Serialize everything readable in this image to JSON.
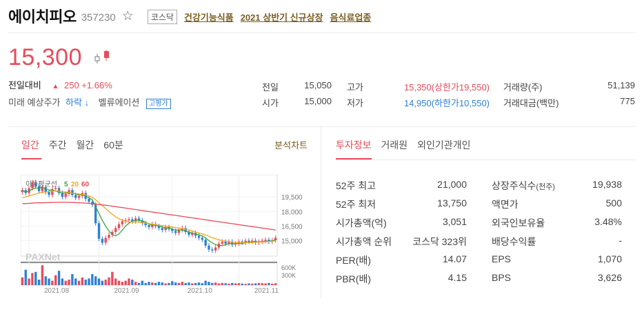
{
  "stock": {
    "name": "에이치피오",
    "code": "357230",
    "market": "코스닥",
    "tags": [
      "건강기능식품",
      "2021 상반기 신규상장",
      "음식료업종"
    ],
    "price": "15,300",
    "change_label": "전일대비",
    "change_value": "250 +1.66%",
    "future_label": "미래 예상주가",
    "future_dir": "하락 ↓",
    "valuation_label": "벨류에이션",
    "valuation_badge": "고평가"
  },
  "summary": [
    {
      "label": "전일",
      "value": "15,050"
    },
    {
      "label": "시가",
      "value": "15,000"
    },
    {
      "label": "고가",
      "value": "15,350(상한가19,550)"
    },
    {
      "label": "저가",
      "value": "14,950(하한가10,550)"
    },
    {
      "label": "거래량(주)",
      "value": "51,139"
    },
    {
      "label": "거래대금(백만)",
      "value": "775"
    }
  ],
  "chart_tabs": [
    "일간",
    "주간",
    "월간",
    "60분"
  ],
  "analysis_link": "분석차트",
  "info_tabs": [
    "투자정보",
    "거래원",
    "외인기관개인"
  ],
  "chart_data": {
    "type": "line",
    "legend_label": "이동평균선",
    "ma_periods": [
      "5",
      "20",
      "60"
    ],
    "ma_colors": [
      "#3aa53a",
      "#f5a623",
      "#e84b5b"
    ],
    "price_ticks": [
      "19,500",
      "18,000",
      "16,500",
      "15,000"
    ],
    "price_tick_values": [
      19500,
      18000,
      16500,
      15000
    ],
    "ylim": [
      13700,
      21500
    ],
    "volume_ticks": [
      "600K",
      "300K"
    ],
    "x_ticks": [
      "2021.08",
      "2021.09",
      "2021.10",
      "2021.11"
    ],
    "watermark": "PAXNet",
    "closes": [
      20200,
      19900,
      20400,
      21000,
      20600,
      20100,
      20500,
      20000,
      19700,
      20300,
      20400,
      19900,
      19500,
      19800,
      20200,
      19700,
      19400,
      19600,
      19900,
      19300,
      19000,
      18700,
      16800,
      15200,
      14800,
      15300,
      15600,
      15900,
      16300,
      16700,
      17000,
      17100,
      17200,
      17000,
      17300,
      17100,
      16800,
      16600,
      16400,
      16700,
      16500,
      16300,
      16100,
      16400,
      16200,
      16000,
      15800,
      16100,
      16300,
      15900,
      15600,
      15800,
      15500,
      15300,
      15100,
      14500,
      14100,
      14000,
      14300,
      14700,
      14900,
      14700,
      14900,
      14600,
      14700,
      14900,
      14800,
      15000,
      14900,
      15000,
      14800,
      14900,
      15000,
      15100,
      14900,
      15050,
      15300
    ],
    "ma5": [
      20200,
      20000,
      20100,
      20300,
      20400,
      20400,
      20500,
      20300,
      20200,
      20200,
      20100,
      20000,
      19900,
      19900,
      19900,
      19900,
      19800,
      19700,
      19700,
      19600,
      19400,
      19200,
      18500,
      17800,
      17100,
      16500,
      16000,
      15600,
      15500,
      15700,
      16100,
      16500,
      16800,
      17000,
      17100,
      17100,
      17000,
      16900,
      16700,
      16600,
      16600,
      16500,
      16400,
      16300,
      16300,
      16200,
      16100,
      16100,
      16100,
      16000,
      15900,
      15800,
      15700,
      15600,
      15500,
      15300,
      15000,
      14800,
      14600,
      14500,
      14500,
      14600,
      14700,
      14700,
      14700,
      14700,
      14700,
      14800,
      14850,
      14900,
      14900,
      14900,
      14900,
      14950,
      14950,
      15000,
      15100
    ],
    "ma20": [
      19400,
      19500,
      19600,
      19700,
      19800,
      19900,
      20000,
      20000,
      20050,
      20100,
      20100,
      20100,
      20050,
      20000,
      19950,
      19900,
      19850,
      19800,
      19750,
      19700,
      19600,
      19450,
      19200,
      18900,
      18600,
      18300,
      18000,
      17700,
      17450,
      17250,
      17100,
      17000,
      16950,
      16900,
      16900,
      16900,
      16850,
      16800,
      16750,
      16700,
      16650,
      16600,
      16550,
      16500,
      16450,
      16400,
      16350,
      16300,
      16250,
      16200,
      16100,
      16000,
      15900,
      15800,
      15700,
      15600,
      15450,
      15300,
      15200,
      15100,
      15000,
      14950,
      14900,
      14850,
      14820,
      14800,
      14800,
      14800,
      14800,
      14820,
      14840,
      14860,
      14880,
      14900,
      14920,
      14950,
      14980
    ],
    "ma60": [
      18800,
      18820,
      18840,
      18860,
      18880,
      18900,
      18900,
      18910,
      18920,
      18930,
      18940,
      18950,
      18950,
      18950,
      18940,
      18930,
      18920,
      18900,
      18880,
      18860,
      18840,
      18800,
      18760,
      18720,
      18680,
      18640,
      18600,
      18550,
      18500,
      18450,
      18400,
      18350,
      18300,
      18250,
      18200,
      18150,
      18100,
      18050,
      18000,
      17950,
      17900,
      17850,
      17800,
      17750,
      17700,
      17650,
      17600,
      17550,
      17500,
      17450,
      17400,
      17350,
      17300,
      17250,
      17200,
      17150,
      17100,
      17050,
      17000,
      16950,
      16900,
      16850,
      16800,
      16750,
      16700,
      16650,
      16600,
      16550,
      16500,
      16450,
      16400,
      16350,
      16300,
      16250,
      16200,
      16150,
      16100
    ],
    "volume": [
      0.35,
      0.7,
      0.3,
      0.55,
      0.6,
      0.25,
      0.9,
      0.4,
      0.3,
      0.2,
      0.45,
      0.65,
      0.3,
      0.2,
      0.25,
      0.5,
      0.3,
      0.2,
      0.35,
      0.25,
      0.3,
      0.5,
      0.4,
      0.3,
      0.2,
      0.25,
      0.35,
      0.6,
      0.3,
      0.2,
      0.15,
      0.2,
      0.3,
      0.25,
      0.15,
      0.1,
      0.2,
      0.1,
      0.15,
      0.12,
      0.1,
      0.15,
      0.12,
      0.08,
      0.1,
      0.18,
      0.12,
      0.1,
      0.15,
      0.1,
      0.12,
      0.08,
      0.1,
      0.12,
      0.09,
      0.2,
      0.15,
      0.1,
      0.12,
      0.08,
      0.1,
      0.09,
      0.07,
      0.1,
      0.08,
      0.09,
      0.07,
      0.06,
      0.08,
      0.07,
      0.08,
      0.1,
      0.09,
      0.08,
      0.1,
      0.07,
      0.09
    ]
  },
  "invest_left": [
    {
      "label": "52주 최고",
      "value": "21,000"
    },
    {
      "label": "52주 최저",
      "value": "13,750"
    },
    {
      "label": "시가총액(억)",
      "value": "3,051"
    },
    {
      "label": "시가총액 순위",
      "value": "코스닥 323위"
    },
    {
      "label": "PER(배)",
      "value": "14.07"
    },
    {
      "label": "PBR(배)",
      "value": "4.15"
    }
  ],
  "invest_right": [
    {
      "label": "상장주식수",
      "sub": "(천주)",
      "value": "19,938"
    },
    {
      "label": "액면가",
      "value": "500"
    },
    {
      "label": "외국인보유율",
      "value": "3.48%"
    },
    {
      "label": "배당수익률",
      "value": "-"
    },
    {
      "label": "EPS",
      "value": "1,070"
    },
    {
      "label": "BPS",
      "value": "3,626"
    }
  ]
}
